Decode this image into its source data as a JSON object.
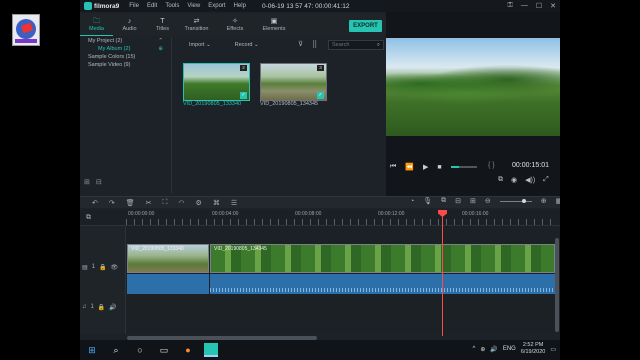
{
  "app": {
    "brand": "filmora9",
    "menu": [
      "File",
      "Edit",
      "Tools",
      "View",
      "Export",
      "Help"
    ],
    "document_title": "0-06-19 13 57 47:  00:00:41:12",
    "window_controls": [
      "⚿",
      "—",
      "☐",
      "✕"
    ]
  },
  "tabs": [
    {
      "label": "Media",
      "icon": "folder-icon",
      "glyph": "🗀"
    },
    {
      "label": "Audio",
      "icon": "music-note-icon",
      "glyph": "♪"
    },
    {
      "label": "Titles",
      "icon": "text-icon",
      "glyph": "T"
    },
    {
      "label": "Transition",
      "icon": "transition-icon",
      "glyph": "⇄"
    },
    {
      "label": "Effects",
      "icon": "effects-icon",
      "glyph": "✧"
    },
    {
      "label": "Elements",
      "icon": "elements-icon",
      "glyph": "▣"
    }
  ],
  "export_label": "EXPORT",
  "sidebar": {
    "items": [
      {
        "label": "My Project (2)",
        "arrow": "⌃",
        "indent": false
      },
      {
        "label": "My Album (2)",
        "arrow": "⊕",
        "indent": true
      },
      {
        "label": "Sample Colors (15)",
        "arrow": "",
        "indent": false
      },
      {
        "label": "Sample Video (9)",
        "arrow": "",
        "indent": false
      }
    ]
  },
  "media_toolbar": {
    "import_label": "Import",
    "record_label": "Record",
    "dropdown_glyph": "⌄",
    "search_placeholder": "Search"
  },
  "media_items": [
    {
      "name": "VID_20190805_133340",
      "badge": "2",
      "selected": true
    },
    {
      "name": "VID_20190805_134345",
      "badge": "3",
      "selected": true
    }
  ],
  "preview": {
    "timecode": "00:00:15:01",
    "braces": "{   }",
    "controls": [
      "⏮",
      "⏪",
      "▶",
      "■"
    ],
    "tools": [
      "⧉",
      "◉",
      "◀))",
      "⤢"
    ]
  },
  "timeline": {
    "toolbar_left": [
      "↶",
      "↷",
      "🗑",
      "✂",
      "⛶",
      "◠",
      "⚙",
      "⌘",
      "☰"
    ],
    "toolbar_right": [
      "◔",
      "🎙",
      "⧉",
      "⊟",
      "⊞",
      "⊖",
      "⊕",
      "▦"
    ],
    "ruler_labels": [
      "00:00:00:00",
      "00:00:04:00",
      "00:00:08:00",
      "00:00:12:00",
      "00:00:16:00"
    ],
    "clips": [
      "VID_20190805_133340",
      "VID_20190805_134345"
    ],
    "video_track_label": "1",
    "audio_track_label": "1",
    "track_icons": [
      "🔒",
      "👁",
      "🔊"
    ]
  },
  "taskbar": {
    "time": "2:52 PM",
    "date": "6/19/2020",
    "tray_glyphs": [
      "^",
      "⊕",
      "🔊",
      "ENG"
    ]
  },
  "colors": {
    "accent": "#27c4b4",
    "playhead": "#ff4a4a",
    "audio_track": "#2d6fa8",
    "app_bg": "#1d2228"
  }
}
